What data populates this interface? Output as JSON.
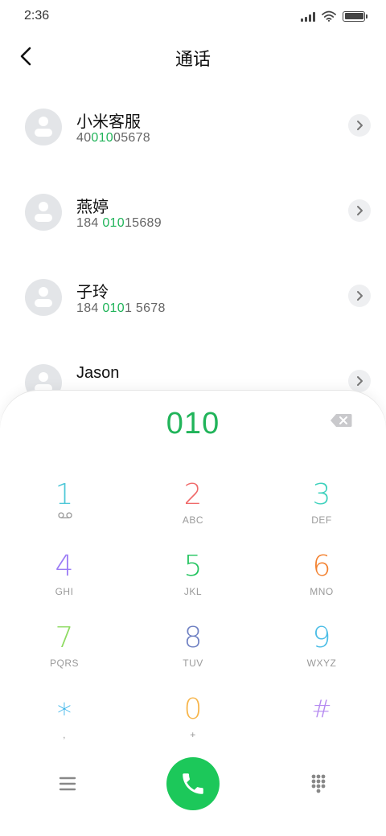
{
  "status_bar": {
    "time": "2:36",
    "icons": [
      "signal-icon",
      "wifi-icon",
      "battery-icon"
    ]
  },
  "nav": {
    "back_icon": "chevron-left-icon",
    "title": "通话"
  },
  "contacts": [
    {
      "name": "小米客服",
      "number_pre": "40",
      "number_match": "010",
      "number_post": "05678"
    },
    {
      "name": "燕婷",
      "number_pre": "184 ",
      "number_match": "010",
      "number_post": "15689"
    },
    {
      "name": "子玲",
      "number_pre": "184 ",
      "number_match": "010",
      "number_post": "1 5678"
    },
    {
      "name": "Jason",
      "number_pre": "",
      "number_match": "",
      "number_post": ""
    }
  ],
  "dialpad": {
    "input": "010",
    "delete_icon": "backspace-icon",
    "keys": [
      {
        "digit": "1",
        "letters": "",
        "sub_icon": "voicemail-icon",
        "color": "#4fc8d8"
      },
      {
        "digit": "2",
        "letters": "ABC",
        "color": "#f06a6a"
      },
      {
        "digit": "3",
        "letters": "DEF",
        "color": "#3ed1bd"
      },
      {
        "digit": "4",
        "letters": "GHI",
        "color": "#9b7cf5"
      },
      {
        "digit": "5",
        "letters": "JKL",
        "color": "#21c45e"
      },
      {
        "digit": "6",
        "letters": "MNO",
        "color": "#f3812f"
      },
      {
        "digit": "7",
        "letters": "PQRS",
        "color": "#8edb62"
      },
      {
        "digit": "8",
        "letters": "TUV",
        "color": "#6d7fc2"
      },
      {
        "digit": "9",
        "letters": "WXYZ",
        "color": "#4bbde6"
      },
      {
        "digit": "*",
        "letters": ",",
        "color": "#2fb0e8"
      },
      {
        "digit": "0",
        "letters": "+",
        "color": "#f7b54a"
      },
      {
        "digit": "#",
        "letters": "",
        "color": "#b58af0"
      }
    ]
  },
  "bottom_bar": {
    "menu_icon": "menu-icon",
    "call_icon": "phone-icon",
    "call_color": "#1cc85a",
    "keypad_icon": "keypad-icon"
  },
  "colors": {
    "accent": "#21b45a",
    "avatar_bg": "#e3e5e8"
  }
}
